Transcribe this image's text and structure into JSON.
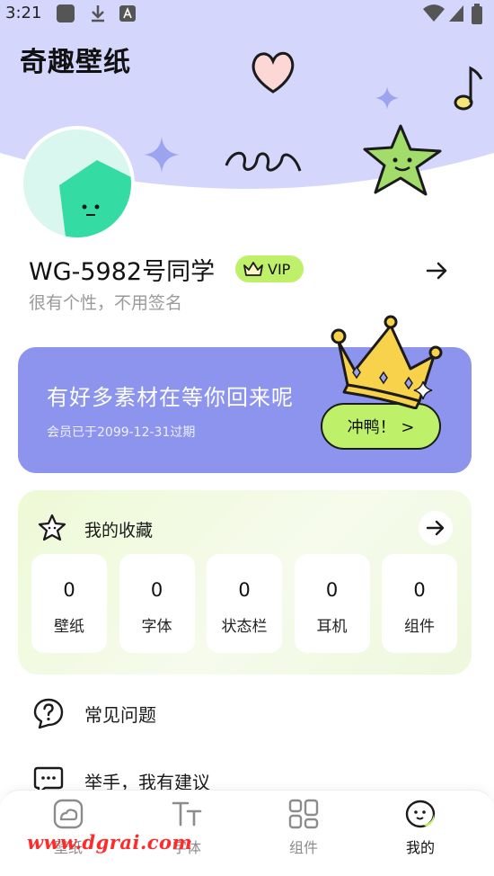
{
  "status_bar": {
    "time": "3:21"
  },
  "app": {
    "title": "奇趣壁纸"
  },
  "profile": {
    "username": "WG-5982号同学",
    "vip_label": "VIP",
    "signature": "很有个性，不用签名"
  },
  "banner": {
    "title": "有好多素材在等你回来呢",
    "expire_text": "会员已于2099-12-31过期",
    "button_label": "冲鸭！ >"
  },
  "favorites": {
    "title": "我的收藏",
    "stats": [
      {
        "value": "0",
        "label": "壁纸"
      },
      {
        "value": "0",
        "label": "字体"
      },
      {
        "value": "0",
        "label": "状态栏"
      },
      {
        "value": "0",
        "label": "耳机"
      },
      {
        "value": "0",
        "label": "组件"
      }
    ]
  },
  "menu": [
    {
      "label": "常见问题",
      "icon": "question-bubble-icon"
    },
    {
      "label": "举手，我有建议",
      "icon": "chat-bubble-icon"
    }
  ],
  "bottom_nav": [
    {
      "label": "壁纸",
      "icon": "wallpaper-icon",
      "active": false
    },
    {
      "label": "字体",
      "icon": "font-icon",
      "active": false
    },
    {
      "label": "组件",
      "icon": "widget-icon",
      "active": false
    },
    {
      "label": "我的",
      "icon": "mascot-icon",
      "active": true
    }
  ],
  "watermark": "www.dgrai.com",
  "colors": {
    "header_bg": "#d4d6fb",
    "banner_bg": "#8c94ee",
    "accent_green": "#bff06a",
    "avatar_bg": "#d9f6ef",
    "avatar_shape": "#34dca3"
  }
}
